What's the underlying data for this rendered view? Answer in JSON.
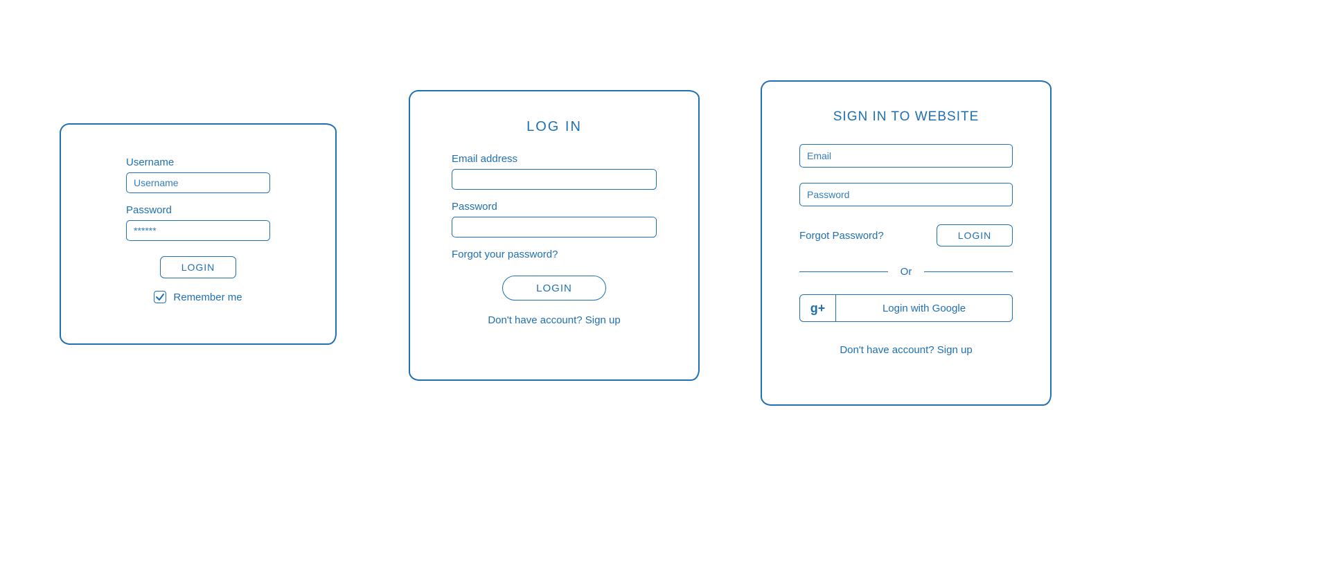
{
  "card1": {
    "username_label": "Username",
    "username_placeholder": "Username",
    "password_label": "Password",
    "password_placeholder": "******",
    "login_label": "LOGIN",
    "remember_label": "Remember me",
    "remember_checked": true
  },
  "card2": {
    "title": "LOG IN",
    "email_label": "Email address",
    "password_label": "Password",
    "forgot_label": "Forgot your password?",
    "login_label": "LOGIN",
    "signup_label": "Don't have account? Sign up"
  },
  "card3": {
    "title": "SIGN IN TO WEBSITE",
    "email_placeholder": "Email",
    "password_placeholder": "Password",
    "forgot_label": "Forgot Password?",
    "login_label": "LOGIN",
    "or_label": "Or",
    "google_icon": "g+",
    "google_label": "Login with Google",
    "signup_label": "Don't have account? Sign up"
  }
}
